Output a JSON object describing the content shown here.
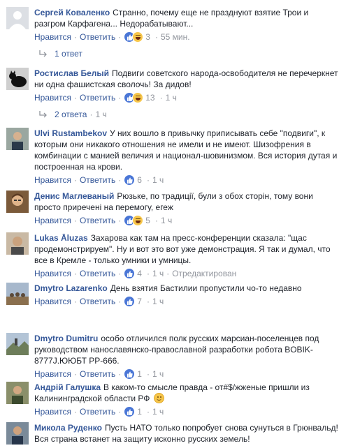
{
  "labels": {
    "like": "Нравится",
    "reply": "Ответить",
    "dot": "·"
  },
  "comments": [
    {
      "author": "Сергей Коваленко",
      "text": "Странно, почему еще не празднуют взятие Трои и разгром Карфагена... Недорабатывают...",
      "reactions": [
        "like",
        "haha"
      ],
      "reaction_count": "3",
      "time": "55 мин.",
      "replies": "1 ответ",
      "replies_time": ""
    },
    {
      "author": "Ростислав Белый",
      "text": "Подвиги советского народа-освободителя не перечеркнет ни одна фашистская сволочь! За дидов!",
      "reactions": [
        "like",
        "haha"
      ],
      "reaction_count": "13",
      "time": "1 ч",
      "replies": "2 ответа",
      "replies_time": "1 ч"
    },
    {
      "author": "Ulvi Rustambekov",
      "text": "У них вошло в привычку приписывать себе \"подвиги\", к которым они никакого отношения не имели и не имеют. Шизофрения в комбинации с манией величия и национал-шовинизмом. Вся история дутая и построенная на крови.",
      "reactions": [
        "like"
      ],
      "reaction_count": "6",
      "time": "1 ч",
      "replies": "",
      "replies_time": ""
    },
    {
      "author": "Денис Маглеваный",
      "text": "Рюзьке, по традиції, були з обох сторін, тому вони просто приречені на перемогу, егеж",
      "reactions": [
        "like",
        "haha"
      ],
      "reaction_count": "5",
      "time": "1 ч",
      "replies": "",
      "replies_time": ""
    },
    {
      "author": "Lukas Āluzas",
      "text": "Захарова как там на пресс-конференции сказала: \"щас продемонстрируем\". Ну и вот это вот уже демонстрация. Я так и думал, что все в Кремле - только умники и умницы.",
      "reactions": [
        "like"
      ],
      "reaction_count": "4",
      "time": "1 ч",
      "edited": "Отредактирован",
      "replies": "",
      "replies_time": ""
    },
    {
      "author": "Dmytro Lazarenko",
      "text": "День взятия Бастилии пропустили чо-то недавно",
      "reactions": [
        "like"
      ],
      "reaction_count": "7",
      "time": "1 ч",
      "replies": "",
      "replies_time": ""
    },
    {
      "author": "Dmytro Dumitru",
      "text": "особо отличился полк русских марсиан-поселенцев под руководством нанославянско-православной разработки робота BOBIK-8777J.ЮЮБТ PP-666.",
      "reactions": [
        "like"
      ],
      "reaction_count": "1",
      "time": "1 ч",
      "replies": "",
      "replies_time": ""
    },
    {
      "author": "Андрій Галушка",
      "text": "В каком-то смысле правда - от#$/жженые пришли из Калининградской области РФ",
      "reactions": [
        "like"
      ],
      "reaction_count": "1",
      "time": "1 ч",
      "replies": "",
      "replies_time": ""
    },
    {
      "author": "Микола Руденко",
      "text": "Пусть НАТО только попробует снова сунуться в Грюнвальд! Вся страна встанет на защиту исконно русских земель!",
      "reactions": [],
      "reaction_count": "",
      "time": "",
      "replies": "",
      "replies_time": ""
    }
  ],
  "colors": {
    "link": "#365899",
    "meta": "#90949c",
    "text": "#1d2129",
    "like_reaction": "#4a76d6",
    "haha_reaction": "#f7c64a"
  },
  "icons": {
    "like": "thumbs-up-icon",
    "haha": "laughing-face-icon",
    "reply_arrow": "reply-arrow-icon",
    "smiley": "smiley-emoji-icon"
  }
}
